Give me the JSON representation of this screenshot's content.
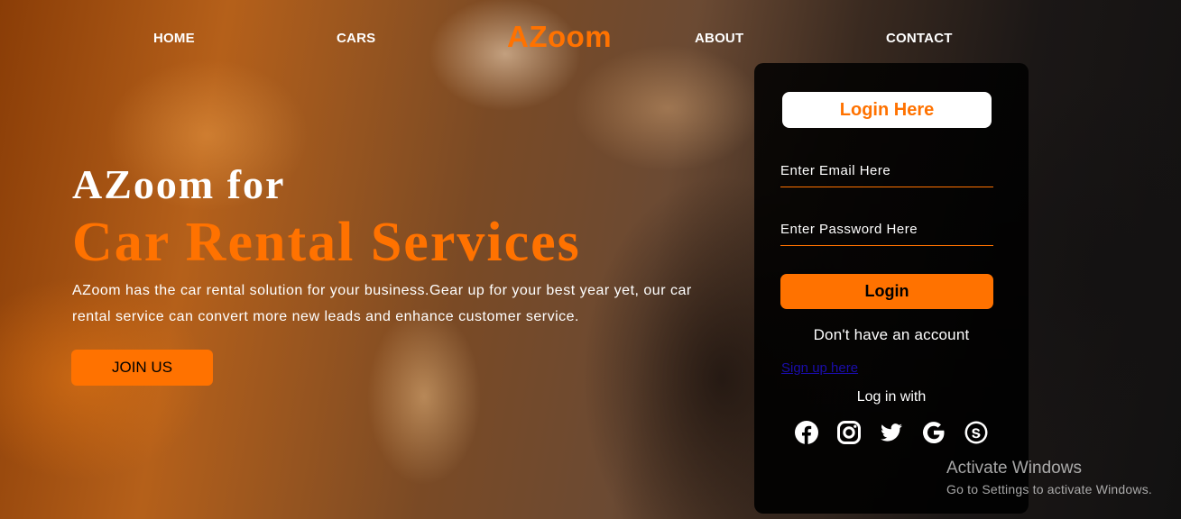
{
  "nav": {
    "home": "HOME",
    "cars": "CARS",
    "logo": "AZoom",
    "about": "ABOUT",
    "contact": "CONTACT"
  },
  "hero": {
    "title_line1": "AZoom for",
    "title_line2": "Car Rental Services",
    "description": "AZoom has the car rental solution for your business.Gear up for your best year yet, our car rental service can convert more new leads and enhance customer service.",
    "join_button": "JOIN US"
  },
  "login": {
    "title": "Login Here",
    "email_placeholder": "Enter Email Here",
    "password_placeholder": "Enter Password Here",
    "login_button": "Login",
    "no_account": "Don't have an account",
    "signup_link": "Sign up here",
    "login_with": "Log in with",
    "social_icons": [
      "facebook-icon",
      "instagram-icon",
      "twitter-icon",
      "google-icon",
      "skype-icon"
    ]
  },
  "watermark": {
    "title": "Activate Windows",
    "subtitle": "Go to Settings to activate Windows."
  },
  "colors": {
    "accent": "#ff7200",
    "link": "#1a0dab"
  }
}
